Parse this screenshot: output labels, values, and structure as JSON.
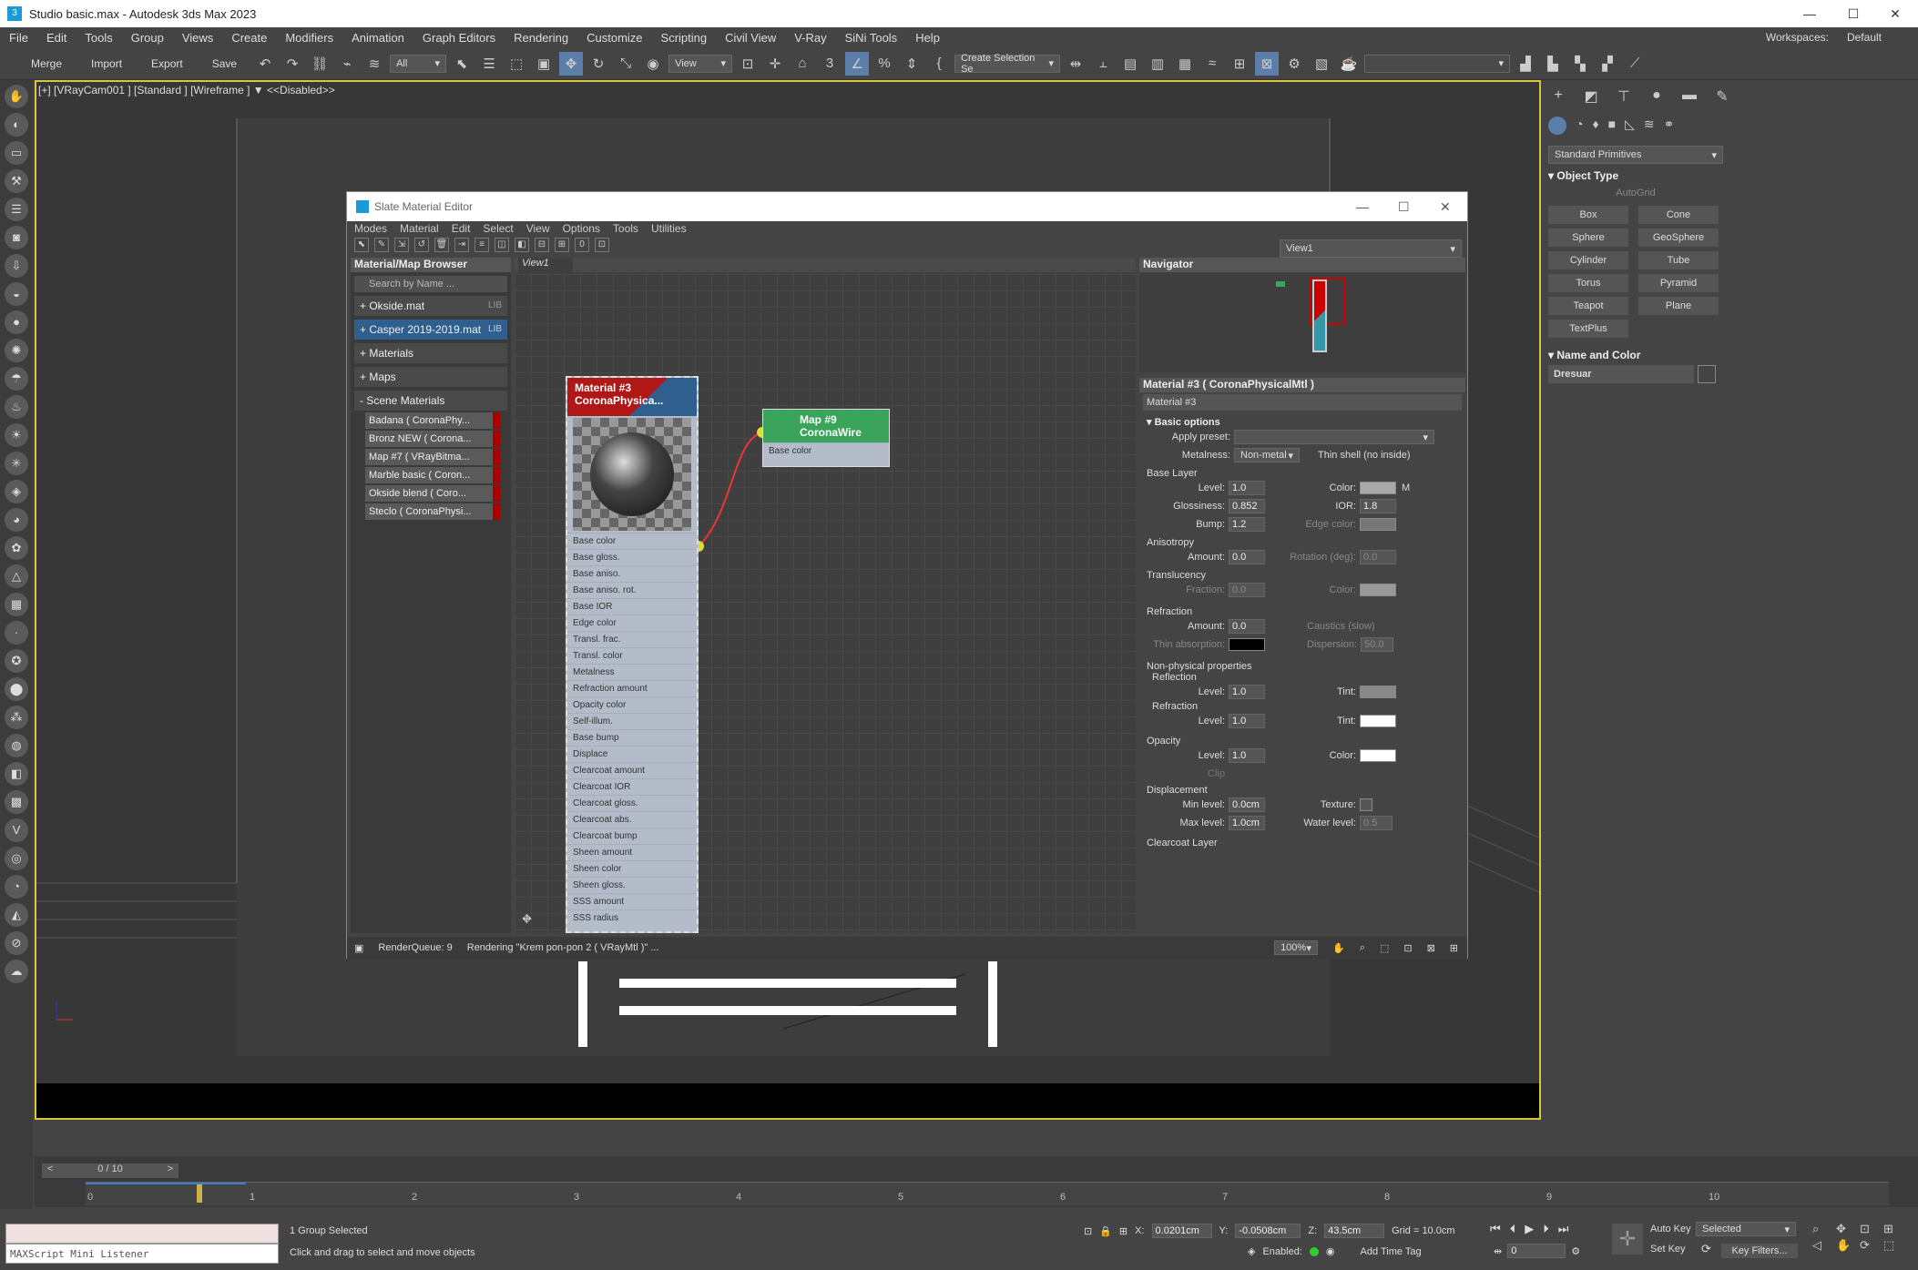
{
  "window": {
    "title": "Studio basic.max - Autodesk 3ds Max 2023",
    "workspaces_label": "Workspaces:",
    "workspace": "Default"
  },
  "menu": [
    "File",
    "Edit",
    "Tools",
    "Group",
    "Views",
    "Create",
    "Modifiers",
    "Animation",
    "Graph Editors",
    "Rendering",
    "Customize",
    "Scripting",
    "Civil View",
    "V-Ray",
    "SiNi Tools",
    "Help"
  ],
  "toolbar": {
    "merge": "Merge",
    "import": "Import",
    "export": "Export",
    "save": "Save",
    "filter": "All",
    "view": "View",
    "selection_set": "Create Selection Se"
  },
  "viewport": {
    "label": "[+] [VRayCam001 ] [Standard ] [Wireframe ]",
    "filter": "<<Disabled>>"
  },
  "command_panel": {
    "category": "Standard Primitives",
    "object_type": "Object Type",
    "autogrid": "AutoGrid",
    "primitives": [
      "Box",
      "Cone",
      "Sphere",
      "GeoSphere",
      "Cylinder",
      "Tube",
      "Torus",
      "Pyramid",
      "Teapot",
      "Plane",
      "TextPlus"
    ],
    "name_and_color": "Name and Color",
    "object_name": "Dresuar"
  },
  "sme": {
    "title": "Slate Material Editor",
    "menu": [
      "Modes",
      "Material",
      "Edit",
      "Select",
      "View",
      "Options",
      "Tools",
      "Utilities"
    ],
    "view_tab": "View1",
    "view_dropdown": "View1",
    "browser": {
      "title": "Material/Map Browser",
      "search": "Search by Name ...",
      "libs": [
        {
          "name": "+ Okside.mat",
          "tag": "LIB"
        },
        {
          "name": "+ Casper 2019-2019.mat",
          "tag": "LIB"
        }
      ],
      "groups": [
        "+ Materials",
        "+ Maps",
        "- Scene Materials"
      ],
      "scene_materials": [
        "Badana  ( CoronaPhy...",
        "Bronz NEW  ( Corona...",
        "Map #7  ( VRayBitma...",
        "Marble basic  ( Coron...",
        "Okside blend  ( Coro...",
        "Steclo  ( CoronaPhysi..."
      ]
    },
    "node_material": {
      "title1": "Material #3",
      "title2": "CoronaPhysica...",
      "slots": [
        "Base color",
        "Base gloss.",
        "Base aniso.",
        "Base aniso. rot.",
        "Base IOR",
        "Edge color",
        "Transl. frac.",
        "Transl. color",
        "Metalness",
        "Refraction amount",
        "Opacity color",
        "Self-illum.",
        "Base bump",
        "Displace",
        "Clearcoat amount",
        "Clearcoat IOR",
        "Clearcoat gloss.",
        "Clearcoat abs.",
        "Clearcoat bump",
        "Sheen amount",
        "Sheen color",
        "Sheen gloss.",
        "SSS amount",
        "SSS radius"
      ]
    },
    "node_map": {
      "title1": "Map #9",
      "title2": "CoronaWire",
      "slot": "Base color"
    },
    "navigator": "Navigator",
    "params": {
      "header": "Material #3  ( CoronaPhysicalMtl )",
      "name": "Material #3",
      "basic": "Basic options",
      "apply_preset": "Apply preset:",
      "metalness": "Metalness:",
      "metalness_val": "Non-metal",
      "thin_shell": "Thin shell (no inside)",
      "base_layer": "Base Layer",
      "level": "Level:",
      "level_val": "1.0",
      "color": "Color:",
      "m": "M",
      "gloss": "Glossiness:",
      "gloss_val": "0.852",
      "ior": "IOR:",
      "ior_val": "1.8",
      "bump": "Bump:",
      "bump_val": "1.2",
      "edge_color": "Edge color:",
      "aniso": "Anisotropy",
      "amount": "Amount:",
      "amount_val": "0.0",
      "rotation": "Rotation (deg):",
      "rotation_val": "0.0",
      "transl": "Translucency",
      "fraction": "Fraction:",
      "fraction_val": "0.0",
      "color2": "Color:",
      "refraction": "Refraction",
      "refr_amount_val": "0.0",
      "caustics": "Caustics (slow)",
      "thin_abs": "Thin absorption:",
      "dispersion": "Dispersion:",
      "dispersion_val": "50.0",
      "nonphys": "Non-physical properties",
      "reflection": "Reflection",
      "tint": "Tint:",
      "refraction2": "Refraction",
      "opacity": "Opacity",
      "clip": "Clip",
      "displacement": "Displacement",
      "min_level": "Min level:",
      "min_val": "0.0cm",
      "texture": "Texture:",
      "max_level": "Max level:",
      "max_val": "1.0cm",
      "water": "Water level:",
      "water_val": "0.5",
      "clearcoat": "Clearcoat Layer"
    },
    "status": {
      "queue": "RenderQueue: 9",
      "rendering": "Rendering \"Krem pon-pon 2  ( VRayMtl )\" ...",
      "zoom": "100%"
    }
  },
  "timeline": {
    "frame": "0 / 10",
    "ticks": [
      "0",
      "1",
      "2",
      "3",
      "4",
      "5",
      "6",
      "7",
      "8",
      "9",
      "10"
    ]
  },
  "status": {
    "listener": "MAXScript Mini Listener",
    "selected": "1 Group Selected",
    "hint": "Click and drag to select and move objects",
    "x_label": "X:",
    "x": "0.0201cm",
    "y_label": "Y:",
    "y": "-0.0508cm",
    "z_label": "Z:",
    "z": "43.5cm",
    "grid": "Grid = 10.0cm",
    "enabled": "Enabled:",
    "add_time_tag": "Add Time Tag",
    "auto_key": "Auto Key",
    "set_key": "Set Key",
    "selected_mode": "Selected",
    "key_filters": "Key Filters...",
    "frame_field": "0"
  }
}
